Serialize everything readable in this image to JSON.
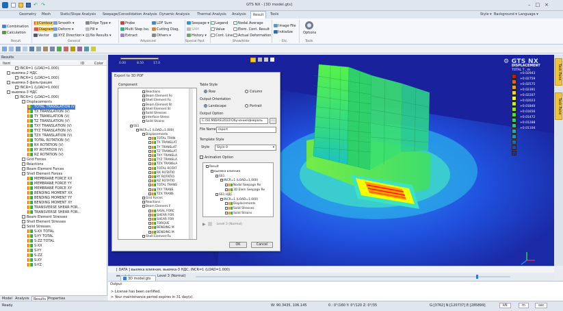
{
  "window": {
    "title": "GTS NX - [3D model.gts]"
  },
  "menu": [
    "Geometry",
    "Mesh",
    "Static/Slope Analysis",
    "Seepage/Consolidation Analysis",
    "Dynamic Analysis",
    "Thermal Analysis",
    "Analysis",
    "Result",
    "Tools"
  ],
  "menu_active": "Result",
  "menu_right": {
    "style": "Style ▾",
    "background": "Background ▾",
    "language": "Language ▾"
  },
  "ribbon": {
    "result_group": {
      "label": "Result",
      "items": [
        "Combination",
        "Calculation"
      ]
    },
    "general_group": {
      "label": "General",
      "items": [
        "Contour",
        "Diagram",
        "Vector",
        "Smooth",
        "Deform",
        "XYZ Direction",
        "Edge Type",
        "Fill",
        "No Results"
      ]
    },
    "advanced_group": {
      "label": "Advanced",
      "items": [
        "Probe",
        "Multi Step Iso.",
        "Extract",
        "LDF Sum",
        "Cutting Diag.",
        "Others"
      ]
    },
    "special_group": {
      "label": "Special Post",
      "items": [
        "Seepage",
        "SAM",
        "History"
      ]
    },
    "showhide_group": {
      "label": "Show/Hide",
      "items": [
        "Legend",
        "Value",
        "Cont. Line",
        "Nodal Average",
        "Elem. Cent. Result",
        "Actual Deformation"
      ]
    },
    "etc_group": {
      "label": "Etc.",
      "items": [
        "Image File",
        "Initialize"
      ]
    },
    "tools_group": {
      "label": "Tools",
      "items": [
        "Options"
      ]
    }
  },
  "left_panel": {
    "title": "Results",
    "columns": [
      "Item",
      "ID",
      "Color"
    ],
    "rows": [
      "INCR=1 (LOAD=1.000)",
      "выемка-2 НДС",
      "INCR=1 (LOAD=1.000)",
      "выемка-3 фильтрация",
      "INCR=1 (LOAD=1.000)",
      "выемка-3 НДС",
      "INCR=1 (LOAD=1.000)",
      "Displacements",
      "TOTAL TRANSLATION (V)",
      "TX TRANSLATION (V)",
      "TY TRANSLATION (V)",
      "TZ TRANSLATION (V)",
      "TXY TRANSLATION (V)",
      "TYZ TRANSLATION (V)",
      "TZX TRANSLATION (V)",
      "TOTAL ROTATION (V)",
      "RX ROTATION (V)",
      "RY ROTATION (V)",
      "RZ ROTATION (V)",
      "Grid Forces",
      "Reactions",
      "Beam Element Forces",
      "Shell Element Forces",
      "MEMBRANE FORCE XX",
      "MEMBRANE FORCE YY",
      "MEMBRANE FORCE XY",
      "BENDING MOMENT XX",
      "BENDING MOMENT YY",
      "BENDING MOMENT XY",
      "TRANSVERSE SHEAR FOR...",
      "TRANSVERSE SHEAR FOR...",
      "Beam Element Stresses",
      "Shell Element Stresses",
      "Solid Stresses",
      "S-XX TOTAL",
      "S-YY TOTAL",
      "S-ZZ TOTAL",
      "S-XX",
      "S-YY",
      "S-ZZ",
      "S-XY",
      "S-YZ"
    ],
    "bottom_tabs": [
      "Model",
      "Analysis",
      "Results",
      "Properties"
    ]
  },
  "dialog": {
    "title": "Export to 3D PDF",
    "component_label": "Component",
    "tree": [
      "Reactions",
      "Beam Element Fo",
      "Shell Element Fo",
      "Beam Element St",
      "Shell Element St",
      "Solid Stresses",
      "Interface Stress",
      "Solid Strains",
      "SS1",
      "INCR=1 (LOAD=1.000)",
      "Displacements",
      "TOTAL TRAN",
      "TX TRANSLAT",
      "TY TRANSLAT",
      "TZ TRANSLAT",
      "TXY TRANSLA",
      "TYZ TRANSLA",
      "TZX TRANSLA",
      "TOTAL ROTAT",
      "RX ROTATIO",
      "RY ROTATIO",
      "RZ ROTATIO",
      "TOTAL TRANS",
      "TXY TRANS",
      "TZX TRANS",
      "Grid Forces",
      "Reactions",
      "Beam Element F",
      "AXIAL FORC",
      "SHEAR FOR",
      "SHEAR FOR",
      "TORQUE",
      "BENDING M",
      "BENDING M",
      "Shell Element Fo"
    ],
    "table_style_label": "Table Style",
    "table_style_options": [
      "Row",
      "Column"
    ],
    "orientation_label": "Output Orientation",
    "orientation_options": [
      "Landscape",
      "Portrait"
    ],
    "output_option_label": "Output Option",
    "output_path": "C:\\50.MIDAS\\2022\\Обучение\\февраль",
    "file_name_label": "File Name",
    "file_name": "report",
    "template_label": "Template Style",
    "style_label": "Style",
    "style_value": "Style 0",
    "animation_label": "Animation Option",
    "anim_tree": [
      "Result",
      "выемка влияния",
      "SS1",
      "INCR=1 (LOAD=1.000)",
      "Nodal Seepage Re",
      "3D Elem Seepage Re",
      "SS1 НДС",
      "INCR=1 (LOAD=1.000)",
      "Displacements",
      "Solid Stresses",
      "Solid Strains"
    ],
    "level_value": "Level 3 (Normal)",
    "ok": "OK",
    "cancel": "Cancel"
  },
  "viewport": {
    "top_scale": [
      "0.00",
      "8.50",
      "17.0"
    ],
    "status_text": "[ DATA ] выемка влияния, выемка-3 НДС, INCR=1 (LOAD=1.000)",
    "level_bar": "Level 3 (Normal)",
    "tab": "3D model.gts"
  },
  "legend": {
    "title": "DISPLACEMENT",
    "subtitle": "TOTAL T , m",
    "values": [
      "+0.02943",
      "+0.02759",
      "+0.02575",
      "+0.02391",
      "+0.02207",
      "+0.02023",
      "+0.01840",
      "+0.01656",
      "+0.01472",
      "+0.01288",
      "+0.01104"
    ],
    "colors": [
      "#ff0000",
      "#ff5a00",
      "#ff9c00",
      "#ffd200",
      "#f2ff00",
      "#b6ff00",
      "#6cff00",
      "#1aff1a",
      "#00e85c",
      "#00d39a",
      "#00b8c8",
      "#00a0e0",
      "#0070f0",
      "#1f3fe0",
      "#1f2ac4"
    ]
  },
  "side_tabs": [
    "Task Pane",
    "Task Pane"
  ],
  "output": {
    "title": "Output",
    "lines": [
      "> License has been certified.",
      "> Your maintenance period expires in 31 day(s)."
    ]
  },
  "statusbar": {
    "ready": "Ready",
    "coord": "W: 90.3435, 106.145",
    "angle": "0 : 0°/160 Y: 0°/120 Z: 0°/35",
    "info": "G:[3762] N:[120737] E:[285899]",
    "unit_kn": "kN",
    "unit_m": "m",
    "unit_sec": "sec"
  }
}
